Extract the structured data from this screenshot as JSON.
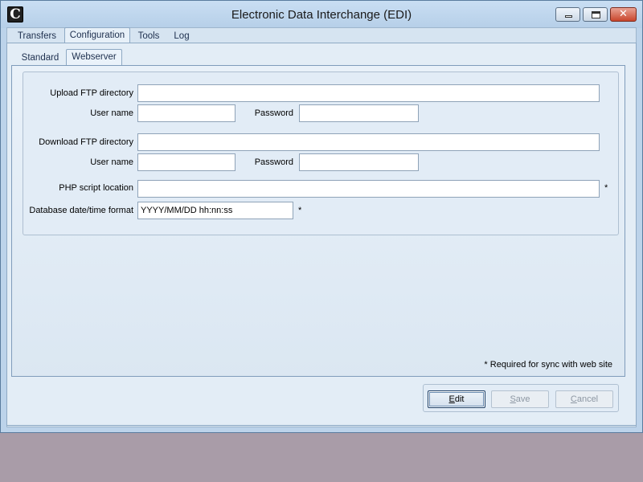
{
  "window": {
    "title": "Electronic Data Interchange (EDI)",
    "app_icon_letter": "C"
  },
  "top_tabs": [
    {
      "label": "Transfers"
    },
    {
      "label": "Configuration"
    },
    {
      "label": "Tools"
    },
    {
      "label": "Log"
    }
  ],
  "sub_tabs": [
    {
      "label": "Standard"
    },
    {
      "label": "Webserver"
    }
  ],
  "form": {
    "upload_ftp_label": "Upload FTP directory",
    "upload_ftp_value": "",
    "upload_user_label": "User name",
    "upload_user_value": "",
    "upload_password_label": "Password",
    "upload_password_value": "",
    "download_ftp_label": "Download FTP directory",
    "download_ftp_value": "",
    "download_user_label": "User name",
    "download_user_value": "",
    "download_password_label": "Password",
    "download_password_value": "",
    "php_label": "PHP script location",
    "php_value": "",
    "db_format_label": "Database date/time format",
    "db_format_value": "YYYY/MM/DD hh:nn:ss",
    "required_marker": "*",
    "required_note": "* Required for sync with web site"
  },
  "buttons": {
    "edit": {
      "label_first": "E",
      "label_rest": "dit"
    },
    "save": {
      "label_first": "S",
      "label_rest": "ave"
    },
    "cancel": {
      "label_first": "C",
      "label_rest": "ancel"
    }
  },
  "colors": {
    "background": "#a99ca8",
    "window": "#bcd3ea",
    "accent": "#1e3f66"
  }
}
